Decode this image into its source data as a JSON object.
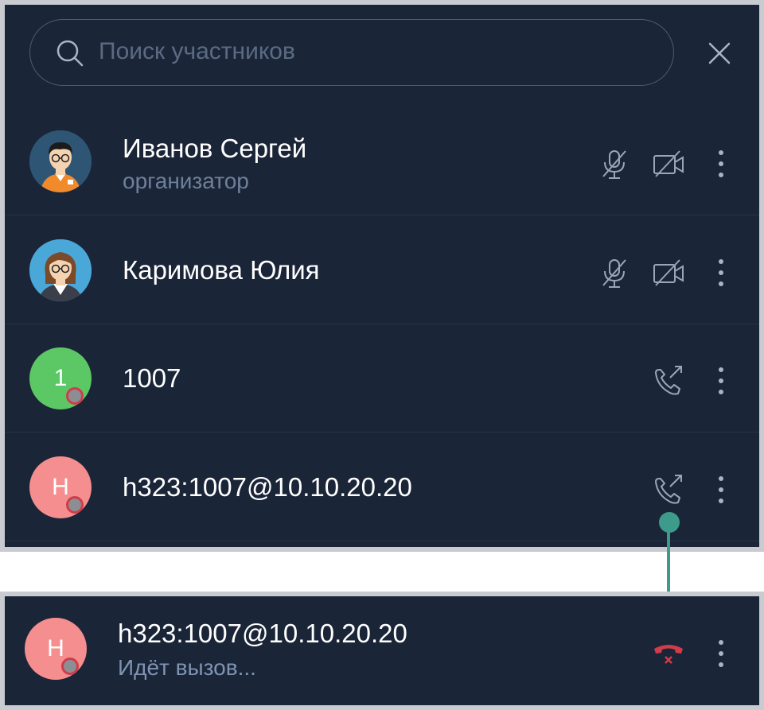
{
  "search": {
    "placeholder": "Поиск участников"
  },
  "participants": [
    {
      "name": "Иванов Сергей",
      "role": "организатор",
      "avatar": "man-avatar",
      "mic": "mic-off-icon",
      "video": "video-off-icon"
    },
    {
      "name": "Каримова Юлия",
      "avatar": "woman-avatar",
      "mic": "mic-off-icon",
      "video": "video-off-icon"
    },
    {
      "name": "1007",
      "initial": "1",
      "avatar_color": "#5cc865",
      "action": "call-icon"
    },
    {
      "name": "h323:1007@10.10.20.20",
      "initial": "H",
      "avatar_color": "#f58e8e",
      "action": "call-icon"
    }
  ],
  "calling": {
    "name": "h323:1007@10.10.20.20",
    "status": "Идёт вызов...",
    "initial": "H",
    "avatar_color": "#f58e8e",
    "action": "hangup-icon"
  },
  "colors": {
    "background": "#1b2538",
    "accent_connector": "#3d9b8b",
    "hangup": "#d23c4a",
    "status_ring": "#d23c4a"
  }
}
